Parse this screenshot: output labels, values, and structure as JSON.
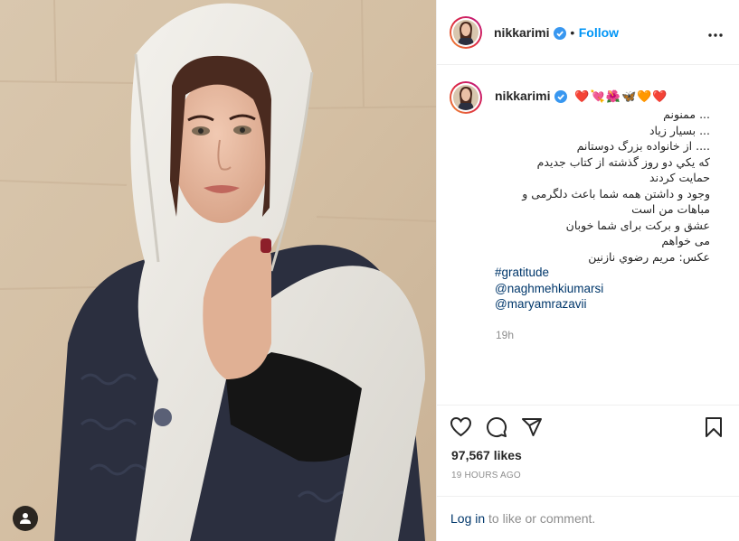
{
  "photo": {
    "alt": "",
    "user_tag_icon": "user-tag-icon"
  },
  "header": {
    "username": "nikkarimi",
    "verified": true,
    "separator": "•",
    "follow_label": "Follow",
    "more_icon": "more-options-icon"
  },
  "caption": {
    "username": "nikkarimi",
    "emojis": "❤️💘🌺🦋🧡❤️",
    "lines": [
      {
        "text": "... ممنونم",
        "dir": "rtl"
      },
      {
        "text": "... بسيار زياد",
        "dir": "rtl"
      },
      {
        "text": ".... از خانواده بزرگ دوستانم",
        "dir": "rtl"
      },
      {
        "text": "كه يكي دو روز گذشته از كتاب جديدم",
        "dir": "rtl"
      },
      {
        "text": "حمايت كردند",
        "dir": "rtl"
      },
      {
        "text": "وجود و داشتن همه شما باعث دلگرمی و",
        "dir": "rtl"
      },
      {
        "text": "مباهات من است",
        "dir": "rtl"
      },
      {
        "text": "عشق و بركت براى شما خوبان",
        "dir": "rtl"
      },
      {
        "text": "مى خواهم",
        "dir": "rtl"
      },
      {
        "text": "عكس: مريم رضوي نازنين",
        "dir": "rtl"
      },
      {
        "text": "#gratitude",
        "dir": "ltr"
      },
      {
        "text": "@naghmehkiumarsi",
        "dir": "ltr"
      },
      {
        "text": "@maryamrazavii",
        "dir": "ltr"
      }
    ],
    "timestamp": "19h"
  },
  "actions": {
    "like_icon": "heart-icon",
    "comment_icon": "comment-icon",
    "share_icon": "share-icon",
    "save_icon": "bookmark-icon"
  },
  "likes": "97,567 likes",
  "posted_ago": "19 HOURS AGO",
  "login": {
    "link": "Log in",
    "rest": " to like or comment."
  },
  "colors": {
    "accent": "#0095f6",
    "link": "#00376b",
    "muted": "#8e8e8e",
    "border": "#efefef"
  }
}
